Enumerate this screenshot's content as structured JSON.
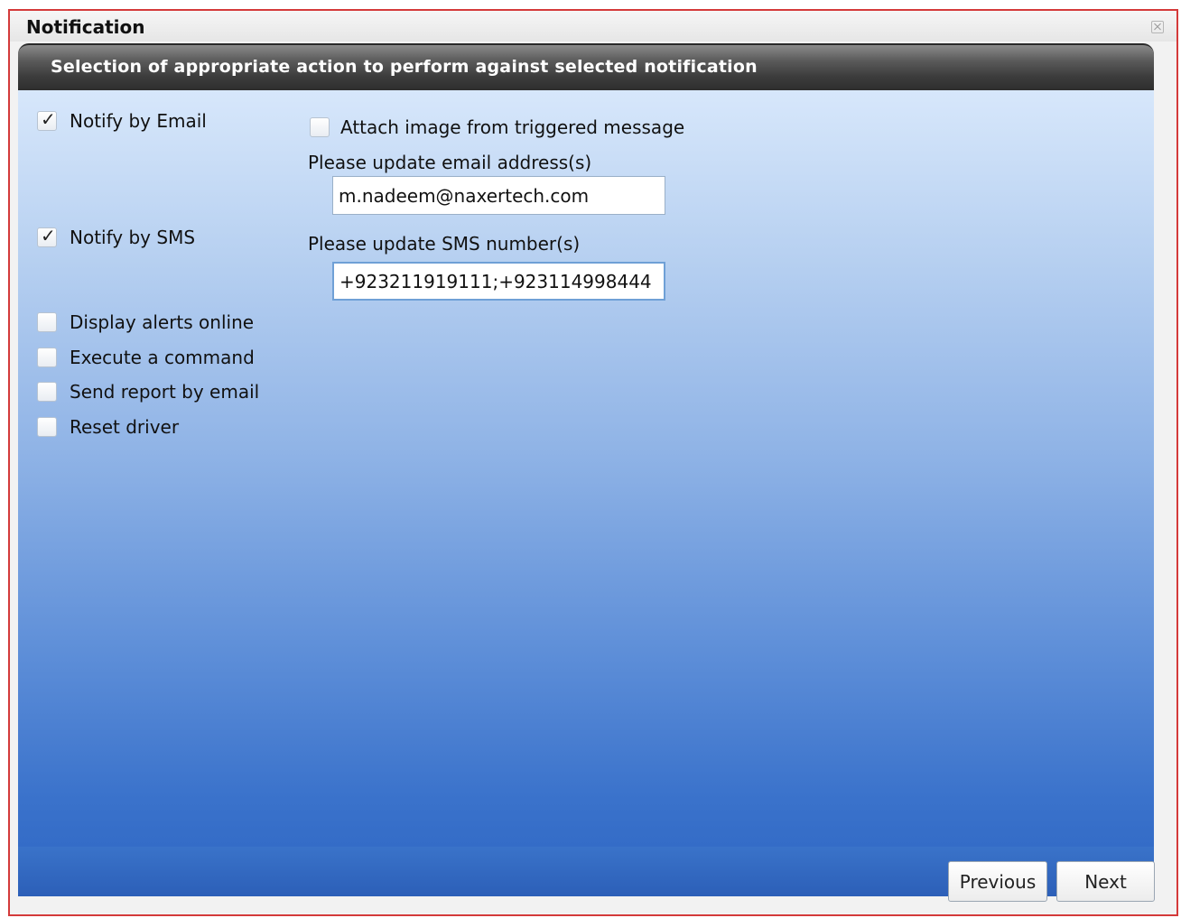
{
  "window": {
    "title": "Notification"
  },
  "panel": {
    "heading": "Selection of appropriate action to perform against selected notification"
  },
  "actions": {
    "notify_email": {
      "label": "Notify by Email",
      "checked": true
    },
    "notify_sms": {
      "label": "Notify by SMS",
      "checked": true
    },
    "display_alerts": {
      "label": "Display alerts online",
      "checked": false
    },
    "execute_command": {
      "label": "Execute a command",
      "checked": false
    },
    "send_report": {
      "label": "Send report by email",
      "checked": false
    },
    "reset_driver": {
      "label": "Reset driver",
      "checked": false
    }
  },
  "email": {
    "attach_image_label": "Attach image from triggered message",
    "attach_image_checked": false,
    "address_label": "Please update email address(s)",
    "address_value": "m.nadeem@naxertech.com"
  },
  "sms": {
    "number_label": "Please update SMS number(s)",
    "number_value": "+923211919111;+923114998444"
  },
  "buttons": {
    "previous": "Previous",
    "next": "Next"
  },
  "icons": {
    "close": "close-icon",
    "check": "checkmark-icon"
  }
}
